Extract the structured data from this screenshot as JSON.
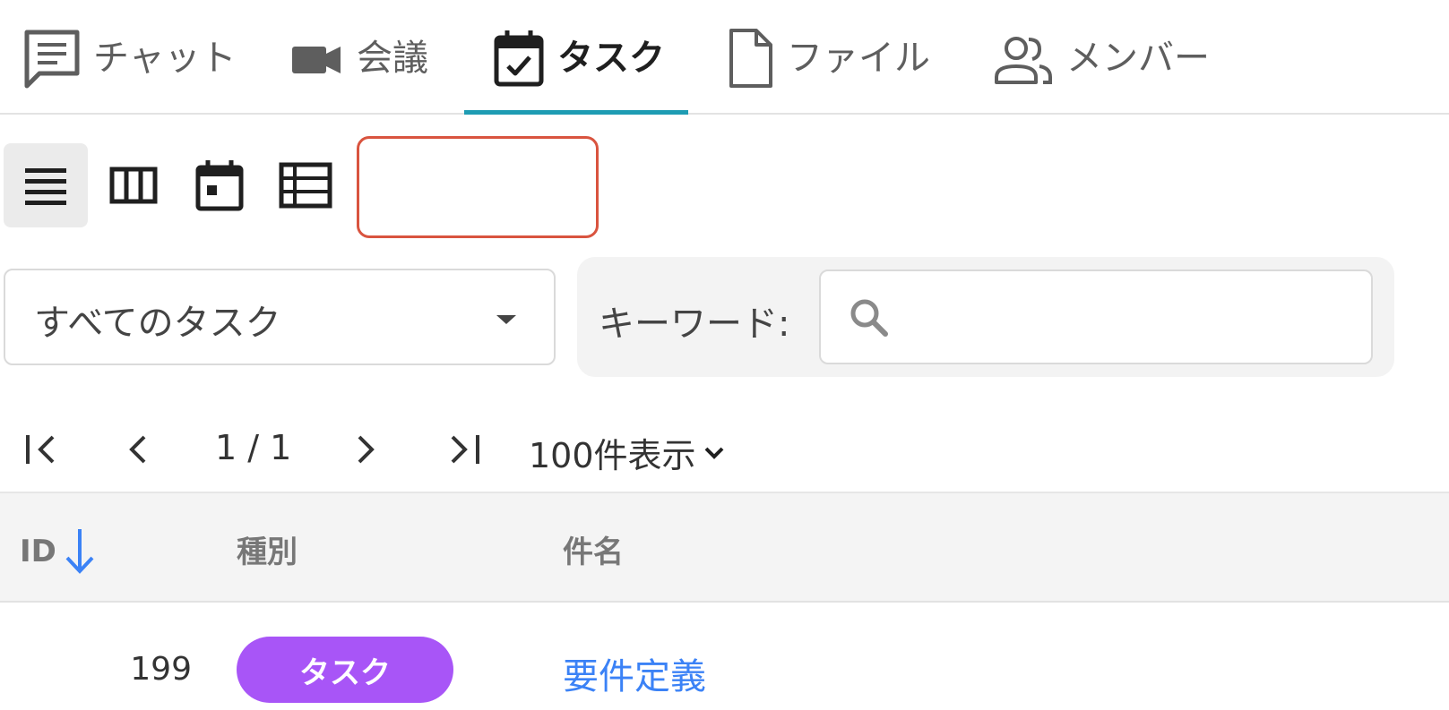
{
  "tabs": [
    {
      "label": "チャット",
      "icon": "chat-icon",
      "active": false
    },
    {
      "label": "会議",
      "icon": "video-camera-icon",
      "active": false
    },
    {
      "label": "タスク",
      "icon": "calendar-check-icon",
      "active": true
    },
    {
      "label": "ファイル",
      "icon": "file-icon",
      "active": false
    },
    {
      "label": "メンバー",
      "icon": "people-icon",
      "active": false
    }
  ],
  "view_modes": [
    {
      "icon": "list-view-icon",
      "active": true
    },
    {
      "icon": "board-view-icon",
      "active": false
    },
    {
      "icon": "calendar-view-icon",
      "active": false
    },
    {
      "icon": "table-view-icon",
      "active": false
    }
  ],
  "filter": {
    "selected": "すべてのタスク",
    "keyword_label": "キーワード:",
    "keyword_value": ""
  },
  "pagination": {
    "page_display": "1 / 1",
    "per_page": "100件表示"
  },
  "table": {
    "columns": [
      "ID",
      "種別",
      "件名"
    ],
    "sort": "id-descending",
    "rows": [
      {
        "id": "199",
        "type": "タスク",
        "title": "要件定義"
      }
    ]
  },
  "colors": {
    "accent": "#1e9cb3",
    "badge": "#a855f7",
    "link": "#3b82f6",
    "highlight": "#d9543f"
  }
}
